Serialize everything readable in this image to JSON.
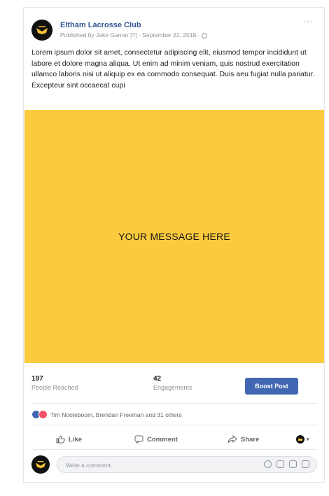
{
  "post": {
    "page_name": "Eltham Lacrosse Club",
    "meta": "Published by Jake Garner [?] · September 22, 2018 · ",
    "more": "···",
    "text": "Lorem ipsum dolor sit amet, consectetur adipiscing elit, eiusmod tempor incididunt ut labore et dolore magna aliqua. Ut enim ad minim veniam, quis nostrud exercitation ullamco laboris nisi ut aliquip ex ea commodo consequat. Duis aeu fugiat nulla pariatur. Excepteur sint occaecat cupi",
    "image_text": "YOUR MESSAGE HERE",
    "image_color": "#fcca3e"
  },
  "stats": {
    "reached_count": "197",
    "reached_label": "People Reached",
    "engagements_count": "42",
    "engagements_label": "Engagements",
    "boost_label": "Boost Post"
  },
  "reactions": {
    "text": "Tim Nooteboom, Brendan Freeman and 31 others"
  },
  "actions": {
    "like": "Like",
    "comment": "Comment",
    "share": "Share"
  },
  "comment": {
    "placeholder": "Write a comment..."
  },
  "colors": {
    "brand": "#4267b2",
    "link": "#365899"
  }
}
